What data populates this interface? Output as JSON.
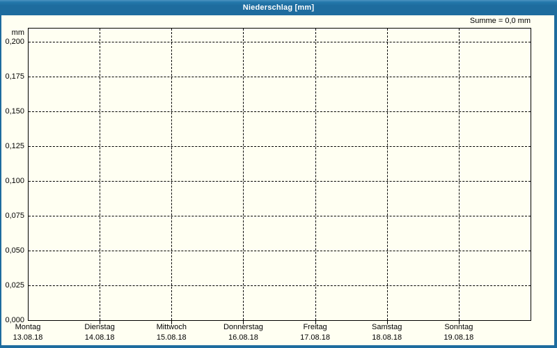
{
  "window": {
    "title": "Niederschlag [mm]",
    "frame_color": "#1e6c9e",
    "background_color": "#fffff2"
  },
  "chart_data": {
    "type": "bar",
    "title": "Niederschlag [mm]",
    "unit_label": "mm",
    "annotation": "Summe = 0,0 mm",
    "sum_value_mm": "0,0",
    "categories": [
      {
        "day": "Montag",
        "date": "13.08.18"
      },
      {
        "day": "Dienstag",
        "date": "14.08.18"
      },
      {
        "day": "Mittwoch",
        "date": "15.08.18"
      },
      {
        "day": "Donnerstag",
        "date": "16.08.18"
      },
      {
        "day": "Freitag",
        "date": "17.08.18"
      },
      {
        "day": "Samstag",
        "date": "18.08.18"
      },
      {
        "day": "Sonntag",
        "date": "19.08.18"
      }
    ],
    "values": [
      0,
      0,
      0,
      0,
      0,
      0,
      0
    ],
    "ylim": [
      0,
      0.2
    ],
    "ytick_step": 0.025,
    "ytick_labels": [
      "0,000",
      "0,025",
      "0,050",
      "0,075",
      "0,100",
      "0,125",
      "0,150",
      "0,175",
      "0,200"
    ],
    "grid": "dashed horizontal and vertical, black on ivory",
    "legend": "none",
    "gridline_color": "#000000"
  }
}
